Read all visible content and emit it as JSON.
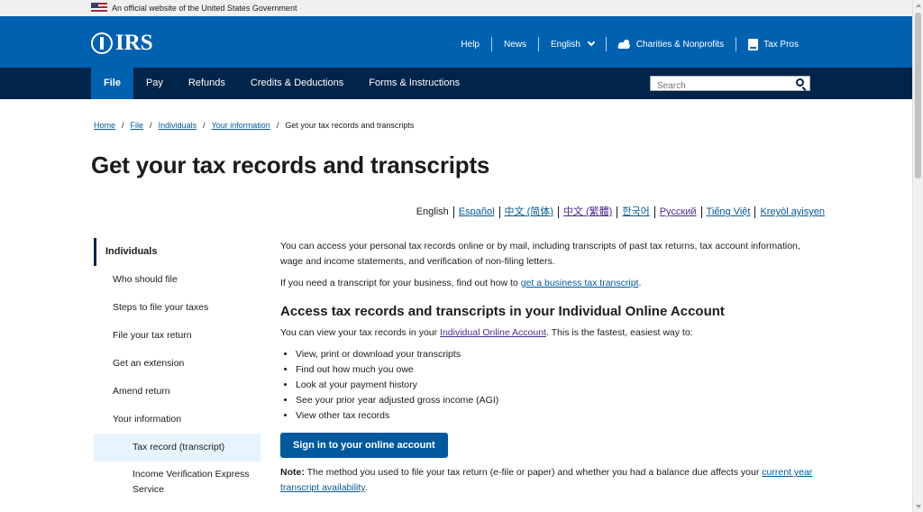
{
  "gov_banner": {
    "text": "An official website of the United States Government"
  },
  "header": {
    "logo_text": "IRS",
    "utility_nav": [
      {
        "label": "Help"
      },
      {
        "label": "News"
      },
      {
        "label": "English"
      },
      {
        "label": "Charities & Nonprofits",
        "icon": "hand-icon"
      },
      {
        "label": "Tax Pros",
        "icon": "book-icon"
      }
    ]
  },
  "main_nav": {
    "items": [
      {
        "label": "File",
        "active": true
      },
      {
        "label": "Pay"
      },
      {
        "label": "Refunds"
      },
      {
        "label": "Credits & Deductions"
      },
      {
        "label": "Forms & Instructions"
      }
    ],
    "search_placeholder": "Search"
  },
  "breadcrumb": {
    "items": [
      "Home",
      "File",
      "Individuals",
      "Your information"
    ],
    "current": "Get your tax records and transcripts"
  },
  "page_title": "Get your tax records and transcripts",
  "languages": {
    "current": "English",
    "options": [
      "Español",
      "中文 (简体)",
      "中文 (繁體)",
      "한국어",
      "Русский",
      "Tiếng Việt",
      "Kreyòl ayisyen"
    ]
  },
  "sidebar": {
    "heading": "Individuals",
    "items": [
      "Who should file",
      "Steps to file your taxes",
      "File your tax return",
      "Get an extension",
      "Amend return",
      "Your information"
    ],
    "sub_items": [
      "Tax record (transcript)",
      "Income Verification Express Service"
    ]
  },
  "content": {
    "intro": "You can access your personal tax records online or by mail, including transcripts of past tax returns, tax account information, wage and income statements, and verification of non-filing letters.",
    "business_prefix": "If you need a transcript for your business, find out how to ",
    "business_link": "get a business tax transcript",
    "business_suffix": ".",
    "section_heading": "Access tax records and transcripts in your Individual Online Account",
    "view_prefix": "You can view your tax records in your ",
    "view_link": "Individual Online Account",
    "view_suffix": ". This is the fastest, easiest way to:",
    "bullets": [
      "View, print or download your transcripts",
      "Find out how much you owe",
      "Look at your payment history",
      "See your prior year adjusted gross income (AGI)",
      "View other tax records"
    ],
    "signin_button": "Sign in to your online account",
    "note_label": "Note:",
    "note_text": " The method you used to file your tax return (e-file or paper) and whether you had a balance due affects your ",
    "note_link": "current year transcript availability",
    "note_suffix": "."
  }
}
